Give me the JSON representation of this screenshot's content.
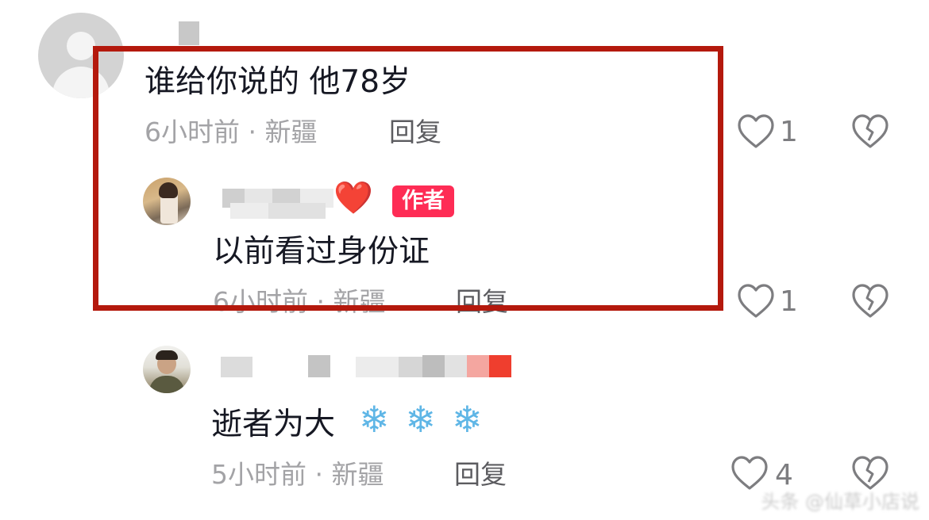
{
  "comments": [
    {
      "text": "谁给你说的 他78岁",
      "time_location": "6小时前 · 新疆",
      "reply_label": "回复",
      "like_count": "1"
    },
    {
      "is_author": true,
      "author_badge": "作者",
      "name_emoji": "❤️",
      "text": "以前看过身份证",
      "time_location": "6小时前 · 新疆",
      "reply_label": "回复",
      "like_count": "1"
    },
    {
      "text": "逝者为大",
      "emoji": [
        "❄",
        "❄",
        "❄"
      ],
      "time_location": "5小时前 · 新疆",
      "reply_label": "回复",
      "like_count": "4"
    }
  ],
  "icons": {
    "like": "heart-outline-icon",
    "dislike": "broken-heart-icon"
  },
  "colors": {
    "highlight_box": "#b4190d",
    "author_badge": "#fe2c55",
    "meta_text": "#a3a3a6"
  },
  "watermark": "头条 @仙草小店说"
}
